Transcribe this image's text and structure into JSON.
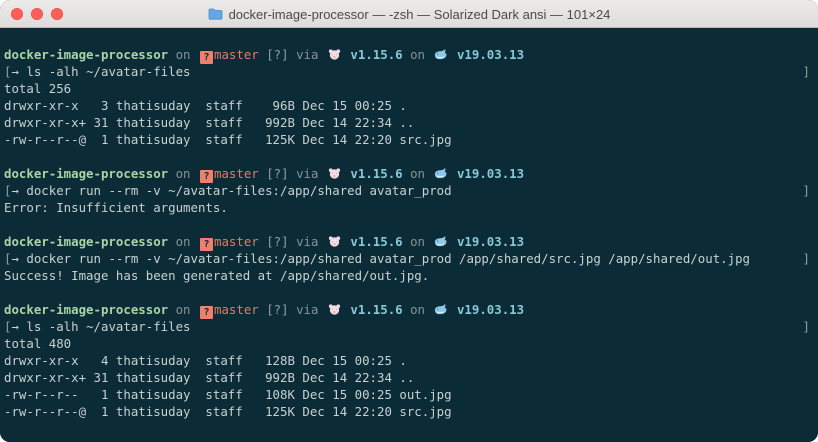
{
  "window": {
    "title": "docker-image-processor — -zsh — Solarized Dark ansi — 101×24",
    "buttons": [
      {
        "name": "close"
      },
      {
        "name": "minimize"
      },
      {
        "name": "zoom"
      }
    ],
    "colors": {
      "background": "#0b2b36",
      "host": "#a8d6a8",
      "branch": "#e47a67",
      "version": "#88c8d8",
      "text": "#c8d1d1",
      "titlebar_text": "#4a4a4a",
      "traffic_light": "#ff5f57"
    }
  },
  "terminal": {
    "blocks": [
      {
        "prompt": {
          "host": "docker-image-processor",
          "on1": "on",
          "git_icon": "?",
          "branch": "master",
          "status": "[?]",
          "via": "via",
          "go_icon": "gopher-icon",
          "go_version": "v1.15.6",
          "on2": "on",
          "docker_icon": "whale-icon",
          "docker_version": "v19.03.13"
        },
        "command": "→ ls -alh ~/avatar-files",
        "output": [
          "total 256",
          "drwxr-xr-x   3 thatisuday  staff    96B Dec 15 00:25 .",
          "drwxr-xr-x+ 31 thatisuday  staff   992B Dec 14 22:34 ..",
          "-rw-r--r--@  1 thatisuday  staff   125K Dec 14 22:20 src.jpg"
        ]
      },
      {
        "prompt": {
          "host": "docker-image-processor",
          "on1": "on",
          "git_icon": "?",
          "branch": "master",
          "status": "[?]",
          "via": "via",
          "go_icon": "gopher-icon",
          "go_version": "v1.15.6",
          "on2": "on",
          "docker_icon": "whale-icon",
          "docker_version": "v19.03.13"
        },
        "command": "→ docker run --rm -v ~/avatar-files:/app/shared avatar_prod",
        "output": [
          "Error: Insufficient arguments."
        ]
      },
      {
        "prompt": {
          "host": "docker-image-processor",
          "on1": "on",
          "git_icon": "?",
          "branch": "master",
          "status": "[?]",
          "via": "via",
          "go_icon": "gopher-icon",
          "go_version": "v1.15.6",
          "on2": "on",
          "docker_icon": "whale-icon",
          "docker_version": "v19.03.13"
        },
        "command": "→ docker run --rm -v ~/avatar-files:/app/shared avatar_prod /app/shared/src.jpg /app/shared/out.jpg",
        "output": [
          "Success! Image has been generated at /app/shared/out.jpg."
        ]
      },
      {
        "prompt": {
          "host": "docker-image-processor",
          "on1": "on",
          "git_icon": "?",
          "branch": "master",
          "status": "[?]",
          "via": "via",
          "go_icon": "gopher-icon",
          "go_version": "v1.15.6",
          "on2": "on",
          "docker_icon": "whale-icon",
          "docker_version": "v19.03.13"
        },
        "command": "→ ls -alh ~/avatar-files",
        "output": [
          "total 480",
          "drwxr-xr-x   4 thatisuday  staff   128B Dec 15 00:25 .",
          "drwxr-xr-x+ 31 thatisuday  staff   992B Dec 14 22:34 ..",
          "-rw-r--r--   1 thatisuday  staff   108K Dec 15 00:25 out.jpg",
          "-rw-r--r--@  1 thatisuday  staff   125K Dec 14 22:20 src.jpg"
        ]
      }
    ]
  }
}
